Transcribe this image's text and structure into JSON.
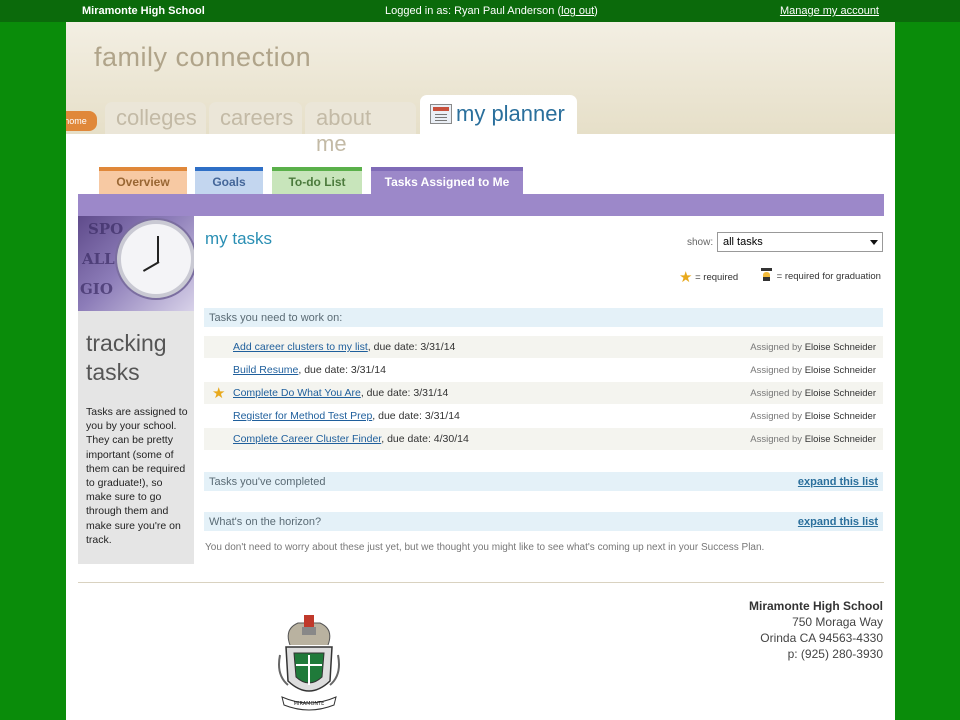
{
  "topbar": {
    "school": "Miramonte High School",
    "logged_in_prefix": "Logged in as: Ryan Paul Anderson (",
    "logout": "log out",
    "logged_in_suffix": ")",
    "manage": "Manage my account"
  },
  "header": {
    "brand": "family connection",
    "home_tab": "home",
    "tabs": [
      "colleges",
      "careers",
      "about me"
    ],
    "active_tab": "my planner"
  },
  "subtabs": [
    "Overview",
    "Goals",
    "To-do List",
    "Tasks Assigned to Me"
  ],
  "sidebar": {
    "image_words": [
      "SPO",
      "ALL",
      "GIO"
    ],
    "title_line1": "tracking",
    "title_line2": "tasks",
    "text": "Tasks are assigned to you by your school. They can be pretty important (some of them can be required to graduate!), so make sure to go through them and make sure you're on track."
  },
  "main": {
    "title": "my tasks",
    "show_label": "show:",
    "show_value": "all tasks",
    "legend_required": "= required",
    "legend_graduation": "= required for graduation",
    "work_on_header": "Tasks you need to work on:",
    "assigned_by_label": "Assigned by",
    "tasks": [
      {
        "title": "Add career clusters to my list",
        "due": ", due date: 3/31/14",
        "assigned_by": "Eloise Schneider",
        "required": false
      },
      {
        "title": "Build Resume",
        "due": ", due date: 3/31/14",
        "assigned_by": "Eloise Schneider",
        "required": false
      },
      {
        "title": "Complete Do What You Are",
        "due": ", due date: 3/31/14",
        "assigned_by": "Eloise Schneider",
        "required": true
      },
      {
        "title": "Register for Method Test Prep",
        "due": ", due date: 3/31/14",
        "assigned_by": "Eloise Schneider",
        "required": false
      },
      {
        "title": "Complete Career Cluster Finder",
        "due": ", due date: 4/30/14",
        "assigned_by": "Eloise Schneider",
        "required": false
      }
    ],
    "completed_header": "Tasks you've completed",
    "horizon_header": "What's on the horizon?",
    "expand_label": "expand this list",
    "horizon_note": "You don't need to worry about these just yet, but we thought you might like to see what's coming up next in your Success Plan."
  },
  "footer": {
    "crest_text": "MIRAMONTE",
    "school_name": "Miramonte High School",
    "street": "750 Moraga Way",
    "city": "Orinda CA 94563-4330",
    "phone": "p: (925) 280-3930"
  },
  "colors": {
    "background_green": "#0a8c0a",
    "topbar_green": "#0b6a0b",
    "purple": "#9c88c9",
    "orange": "#e0883a",
    "link_blue": "#1f5f9c",
    "star": "#e8a91c"
  }
}
